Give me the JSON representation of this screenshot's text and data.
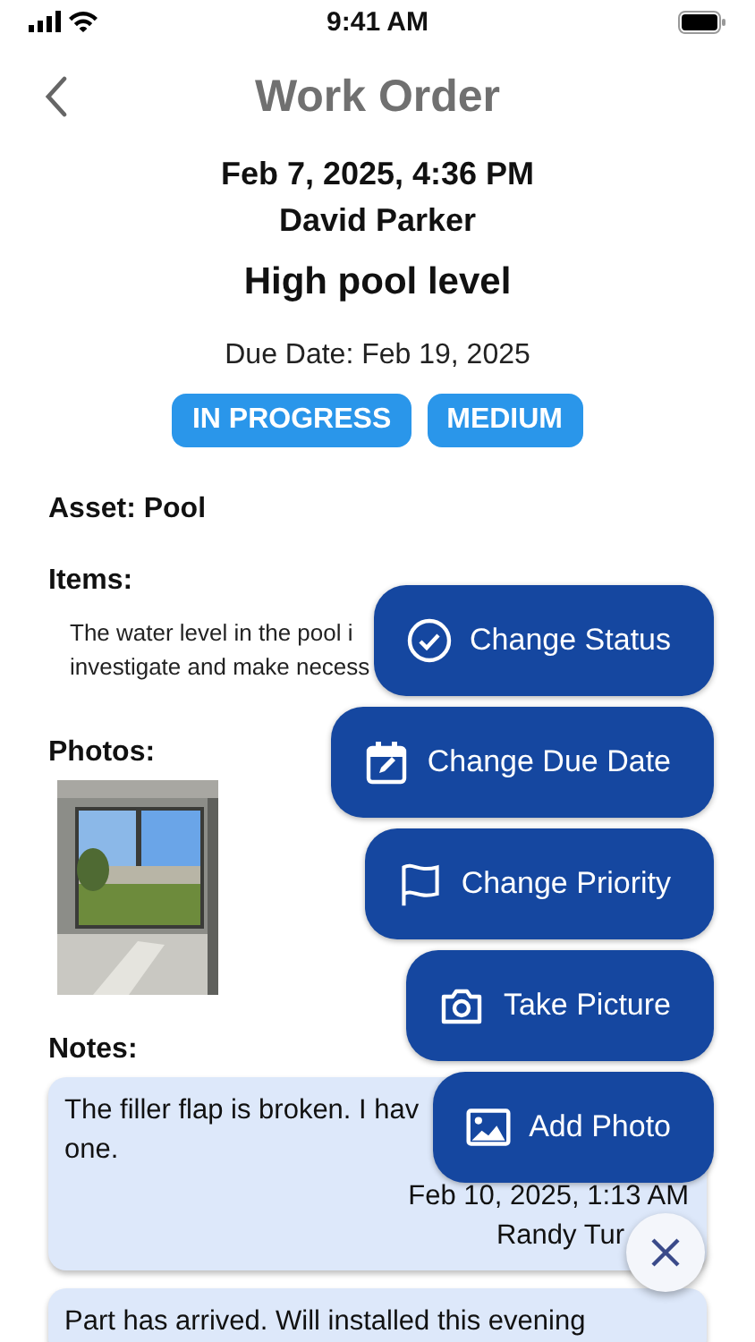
{
  "status_bar": {
    "time": "9:41 AM"
  },
  "header": {
    "title": "Work Order"
  },
  "order": {
    "created": "Feb 7, 2025, 4:36 PM",
    "author": "David Parker",
    "title": "High pool level",
    "due_date": "Due Date: Feb 19, 2025",
    "badges": [
      {
        "label": "IN PROGRESS"
      },
      {
        "label": "MEDIUM"
      }
    ]
  },
  "asset": "Asset: Pool",
  "items": {
    "heading": "Items:",
    "text_lines": [
      "The water level in the pool i",
      "investigate and make necess"
    ]
  },
  "photos": {
    "heading": "Photos:"
  },
  "notes": {
    "heading": "Notes:",
    "items": [
      {
        "text_lines": [
          "The filler flap is broken. I hav",
          "one."
        ],
        "date": "Feb 10, 2025, 1:13 AM",
        "author": "Randy Tur"
      },
      {
        "text_lines": [
          "Part has arrived. Will installed this evening"
        ]
      }
    ]
  },
  "actions": [
    {
      "kind": "status",
      "label": "Change Status"
    },
    {
      "kind": "due_date",
      "label": "Change Due Date"
    },
    {
      "kind": "priority",
      "label": "Change Priority"
    },
    {
      "kind": "camera",
      "label": "Take Picture"
    },
    {
      "label": "Add Photo"
    }
  ]
}
